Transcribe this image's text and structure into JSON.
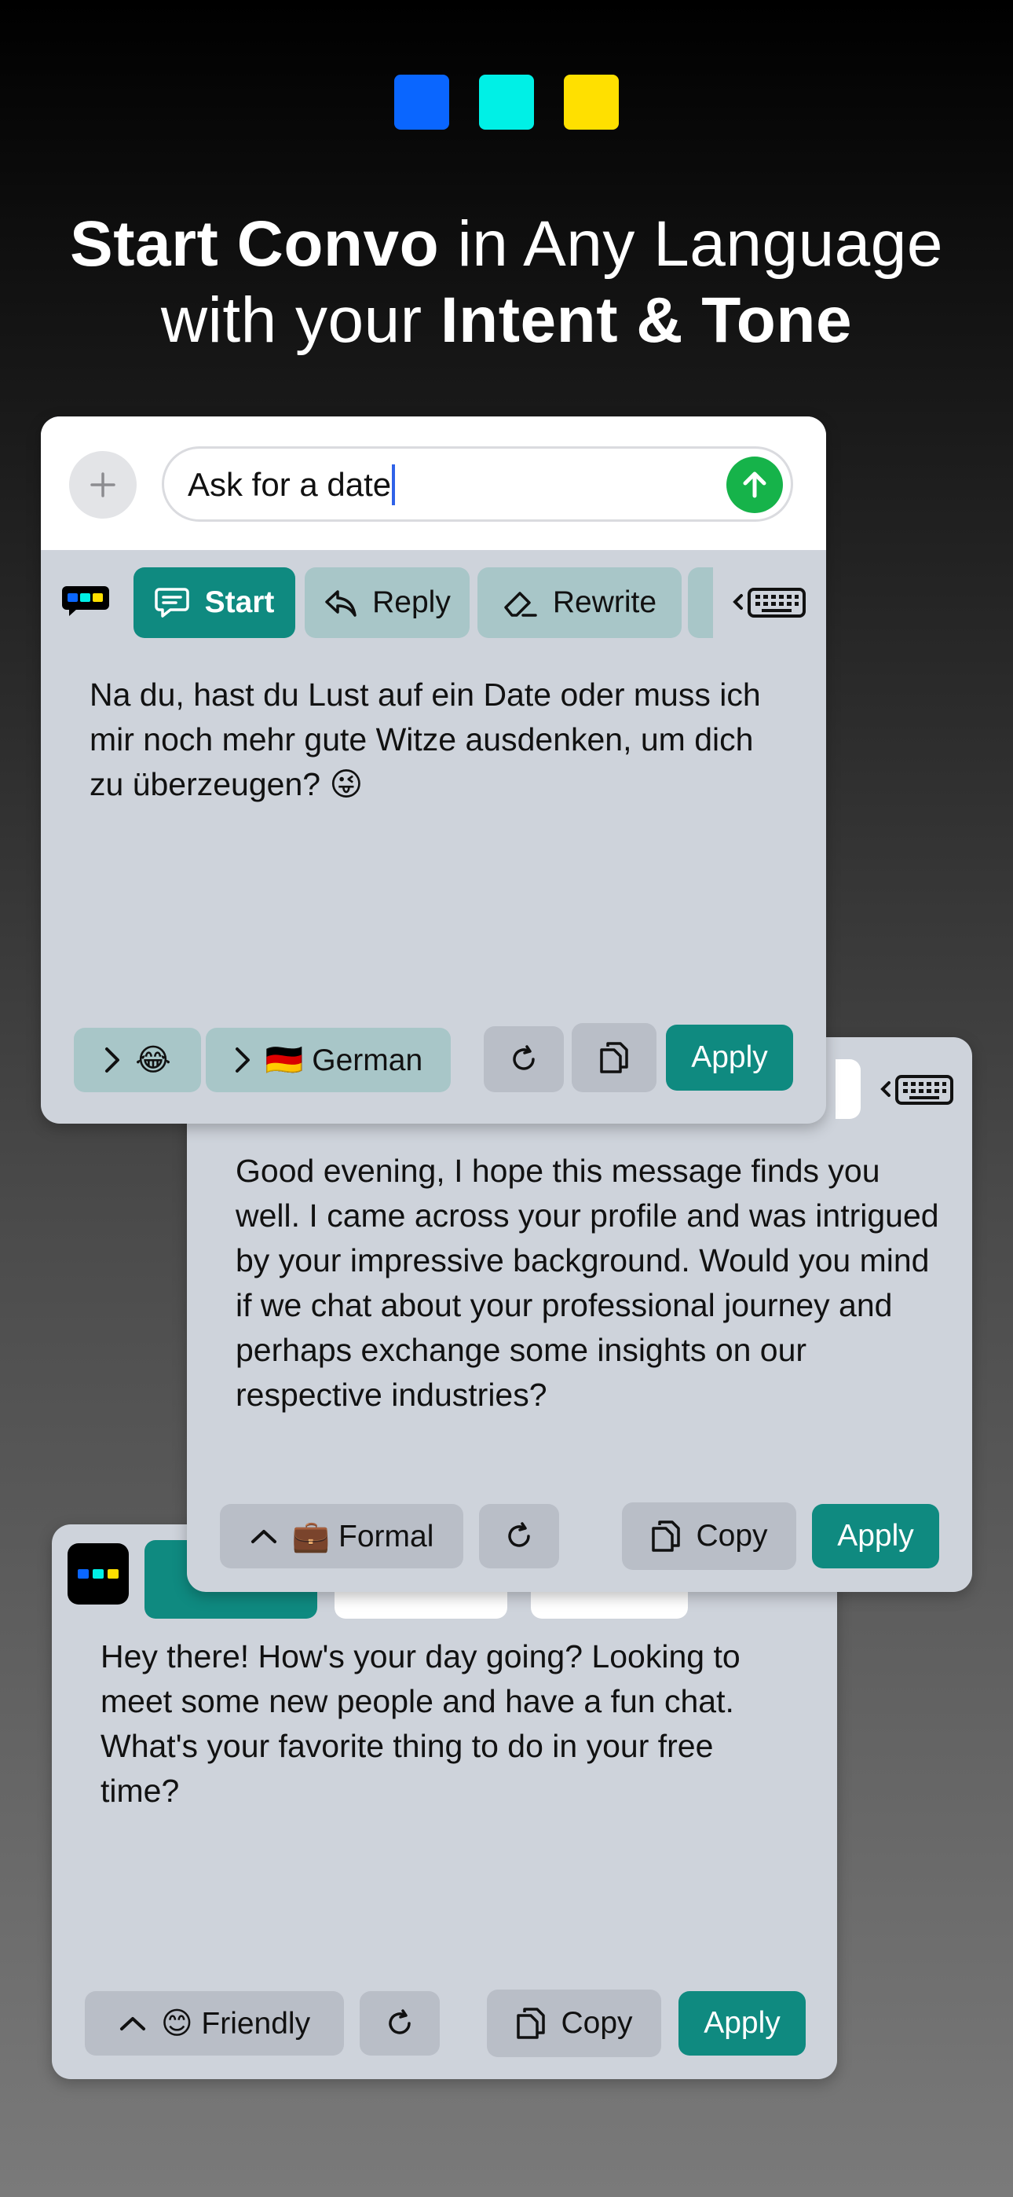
{
  "colors": {
    "square_blue": "#0a66ff",
    "square_cyan": "#00f0e6",
    "square_yellow": "#ffe000",
    "teal": "#0f8a80",
    "card_bg": "#ced3db"
  },
  "headline": {
    "line1_bold": "Start Convo",
    "line1_rest": " in Any Language",
    "line2_start": "with your ",
    "line2_bold": "Intent & Tone"
  },
  "card_a": {
    "input_value": "Ask for a date",
    "tabs": {
      "start": "Start",
      "reply": "Reply",
      "rewrite": "Rewrite"
    },
    "message": "Na du, hast du Lust auf ein Date oder muss ich mir noch mehr gute Witze ausdenken, um dich zu überzeugen? 😜",
    "emoji_selector": "😂",
    "language_flag": "🇩🇪",
    "language": "German",
    "apply_label": "Apply"
  },
  "card_b": {
    "message": "Good evening, I hope this message finds you well. I came across your profile and was intrigued by your impressive background. Would you mind if we chat about your professional journey and perhaps exchange some insights on our respective industries?",
    "tone_emoji": "💼",
    "tone": "Formal",
    "copy_label": "Copy",
    "apply_label": "Apply"
  },
  "card_c": {
    "message": "Hey there! How's your day going? Looking to meet some new people and have a fun chat. What's your favorite thing to do in your free time?",
    "tone_emoji": "😊",
    "tone": "Friendly",
    "copy_label": "Copy",
    "apply_label": "Apply"
  },
  "icons": [
    "plus-icon",
    "send-arrow-icon",
    "app-logo-icon",
    "chat-bubble-icon",
    "reply-arrow-icon",
    "eraser-icon",
    "keyboard-icon",
    "chevron-right-icon",
    "chevron-up-icon",
    "refresh-icon",
    "copy-icon"
  ]
}
